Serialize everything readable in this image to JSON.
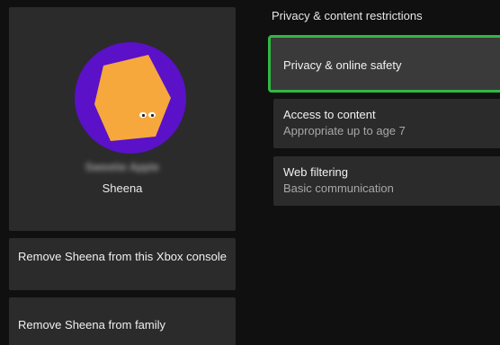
{
  "profile": {
    "gamertag": "Sweetie Apple",
    "display_name": "Sheena",
    "avatar_icon": "hexagon-character-avatar",
    "avatar_bg_color": "#5a11c8",
    "avatar_shape_color": "#f6a83c"
  },
  "actions": {
    "remove_console_label": "Remove Sheena from this Xbox console",
    "remove_family_label": "Remove Sheena from family"
  },
  "restrictions": {
    "title": "Privacy & content restrictions",
    "focus_color": "#2fb843",
    "items": [
      {
        "label": "Privacy & online safety",
        "sub": ""
      },
      {
        "label": "Access to content",
        "sub": "Appropriate up to age 7"
      },
      {
        "label": "Web filtering",
        "sub": "Basic communication"
      }
    ]
  }
}
